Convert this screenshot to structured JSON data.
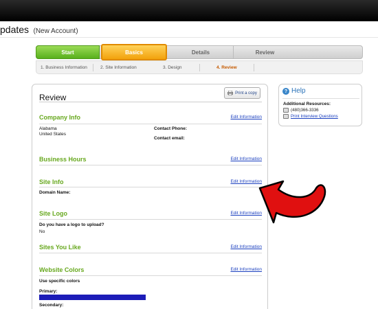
{
  "header": {
    "title": "pdates",
    "subtitle": "(New Account)"
  },
  "wizard": {
    "steps": [
      {
        "label": "Start"
      },
      {
        "label": "Basics"
      },
      {
        "label": "Details"
      },
      {
        "label": "Review"
      }
    ],
    "substeps": [
      {
        "label": "1. Business Information"
      },
      {
        "label": "2. Site Information"
      },
      {
        "label": "3. Design"
      },
      {
        "label": "4. Review"
      }
    ]
  },
  "review": {
    "title": "Review",
    "print_label": "Print a copy",
    "edit_label": "Edit Information",
    "sections": {
      "company_info": {
        "title": "Company Info",
        "address_line1": "Alabama",
        "address_line2": "United States",
        "contact_phone_label": "Contact Phone:",
        "contact_email_label": "Contact email:"
      },
      "business_hours": {
        "title": "Business Hours"
      },
      "site_info": {
        "title": "Site Info",
        "domain_label": "Domain Name:"
      },
      "site_logo": {
        "title": "Site Logo",
        "question": "Do you have a logo to upload?",
        "answer": "No"
      },
      "sites_you_like": {
        "title": "Sites You Like"
      },
      "website_colors": {
        "title": "Website Colors",
        "option": "Use specific colors",
        "primary_label": "Primary:",
        "primary_color": "#1c1cb8",
        "secondary_label": "Secondary:"
      }
    }
  },
  "help": {
    "title": "Help",
    "resources_label": "Additional Resources:",
    "phone": "(480)366-3336",
    "print_link": "Print Interview Questions"
  },
  "colors": {
    "accent_green": "#67a81e",
    "link_blue": "#1a3fbf",
    "annotation_red": "#e01010"
  }
}
